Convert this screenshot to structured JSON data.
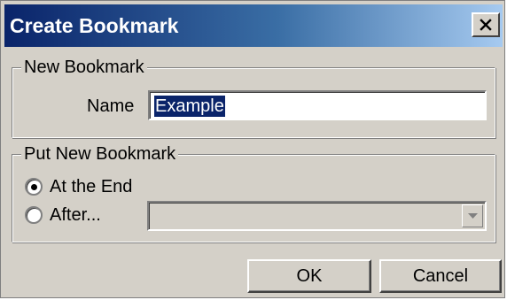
{
  "window": {
    "title": "Create Bookmark",
    "close_icon": "close-icon"
  },
  "new_bookmark": {
    "legend": "New Bookmark",
    "name_label": "Name",
    "name_value": "Example"
  },
  "placement": {
    "legend": "Put New Bookmark",
    "options": [
      {
        "label": "At the End",
        "selected": true
      },
      {
        "label": "After...",
        "selected": false
      }
    ],
    "after_dropdown_value": "",
    "after_dropdown_enabled": false
  },
  "buttons": {
    "ok_label": "OK",
    "cancel_label": "Cancel"
  },
  "colors": {
    "titlebar_start": "#0a246a",
    "titlebar_end": "#a6caf0",
    "dialog_bg": "#d4d0c8",
    "selection_bg": "#0a246a"
  }
}
